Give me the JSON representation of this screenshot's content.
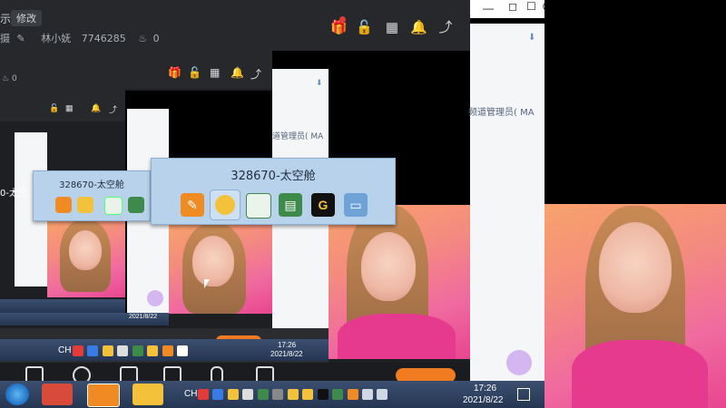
{
  "app": {
    "header_left_text": "示",
    "edit_label": "修改",
    "row2_prefix": "摄",
    "username": "林小妩",
    "user_id": "7746285",
    "fire_count": "0"
  },
  "nested": {
    "fire_count": "0",
    "side_text_1": "频道管理员( MA",
    "side_text_2": "道管理员( MA",
    "inner_label": "328670-太空舱"
  },
  "popup": {
    "title": "328670-太空舱",
    "icons": [
      "shield-app-icon",
      "bee-mascot-icon",
      "window-icon",
      "chart-icon",
      "g-logo-icon",
      "monitor-icon"
    ]
  },
  "taskbar": {
    "lang": "CH",
    "time": "17:26",
    "date": "2021/8/22"
  },
  "nested_taskbar": {
    "time": "17:26",
    "date": "2021/8/22"
  },
  "colors": {
    "popup_bg": "#b9d2ec",
    "taskbar": "#253653",
    "dark_app": "#1d1f22",
    "accent_orange": "#f07b20",
    "badge_red": "#e33a3a"
  }
}
